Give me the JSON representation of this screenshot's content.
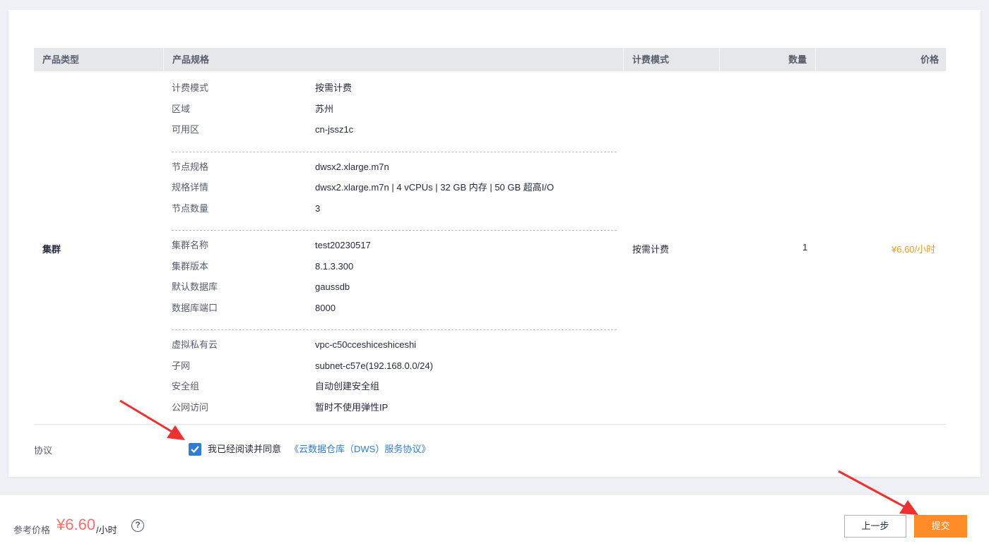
{
  "table": {
    "headers": {
      "product_type": "产品类型",
      "product_spec": "产品规格",
      "billing_mode": "计费模式",
      "quantity": "数量",
      "price": "价格"
    },
    "row": {
      "product_type": "集群",
      "billing_mode": "按需计费",
      "quantity": "1",
      "price": "¥6.60/小时"
    },
    "spec_groups": [
      [
        {
          "k": "计费模式",
          "v": "按需计费"
        },
        {
          "k": "区域",
          "v": "苏州"
        },
        {
          "k": "可用区",
          "v": "cn-jssz1c"
        }
      ],
      [
        {
          "k": "节点规格",
          "v": "dwsx2.xlarge.m7n"
        },
        {
          "k": "规格详情",
          "v": "dwsx2.xlarge.m7n | 4 vCPUs | 32 GB 内存 | 50 GB 超高I/O"
        },
        {
          "k": "节点数量",
          "v": "3"
        }
      ],
      [
        {
          "k": "集群名称",
          "v": "test20230517"
        },
        {
          "k": "集群版本",
          "v": "8.1.3.300"
        },
        {
          "k": "默认数据库",
          "v": "gaussdb"
        },
        {
          "k": "数据库端口",
          "v": "8000"
        }
      ],
      [
        {
          "k": "虚拟私有云",
          "v": "vpc-c50cceshiceshiceshi"
        },
        {
          "k": "子网",
          "v": "subnet-c57e(192.168.0.0/24)"
        },
        {
          "k": "安全组",
          "v": "自动创建安全组"
        },
        {
          "k": "公网访问",
          "v": "暂时不使用弹性IP"
        }
      ]
    ]
  },
  "agreement": {
    "label": "协议",
    "checked": true,
    "text": "我已经阅读并同意",
    "link": "《云数据仓库（DWS）服务协议》"
  },
  "footer": {
    "ref_label": "参考价格",
    "ref_price": "¥6.60",
    "ref_unit": "/小时",
    "help_icon": "question-circle-icon",
    "help_glyph": "?",
    "prev_label": "上一步",
    "submit_label": "提交"
  },
  "colors": {
    "accent": "#ff8b29",
    "price_orange": "#f59a23",
    "ref_price_red": "#f66f6a",
    "link_blue": "#2d7cd6",
    "annotation_arrow": "#f0302f"
  }
}
